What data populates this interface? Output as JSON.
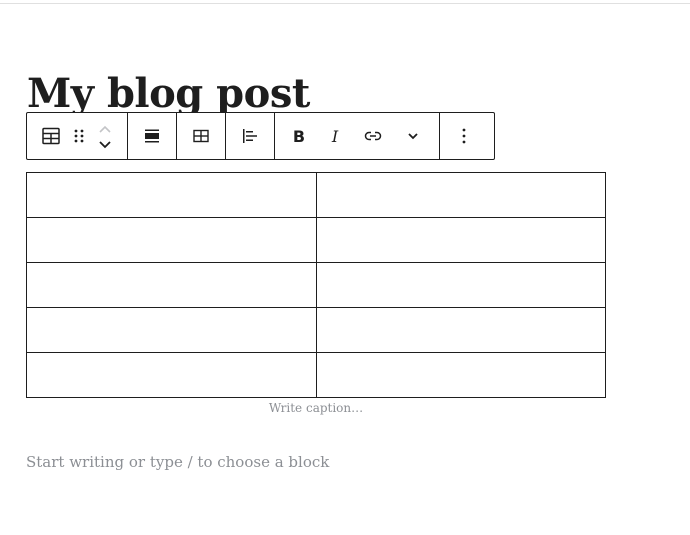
{
  "post": {
    "title": "My blog post"
  },
  "toolbar": {
    "groups": [
      {
        "name": "block-controls",
        "items": [
          "table-block-icon",
          "drag-handle-icon",
          "move-up-icon",
          "move-down-icon"
        ]
      },
      {
        "name": "align",
        "items": [
          "align-wide-icon"
        ]
      },
      {
        "name": "table-edit",
        "items": [
          "table-edit-icon"
        ]
      },
      {
        "name": "column-align",
        "items": [
          "align-left-icon"
        ]
      },
      {
        "name": "format",
        "items": [
          "bold-icon",
          "italic-icon",
          "link-icon",
          "chevron-down-icon"
        ]
      },
      {
        "name": "options",
        "items": [
          "more-vertical-icon"
        ]
      }
    ],
    "bold_label": "B",
    "italic_label": "I"
  },
  "table": {
    "rows": [
      [
        "",
        ""
      ],
      [
        "",
        ""
      ],
      [
        "",
        ""
      ],
      [
        "",
        ""
      ],
      [
        "",
        ""
      ]
    ]
  },
  "caption": {
    "placeholder": "Write caption…"
  },
  "appender": {
    "placeholder": "Start writing or type / to choose a block"
  },
  "colors": {
    "text": "#1e1e1e",
    "placeholder": "#8c8f94",
    "border": "#1e1e1e"
  }
}
